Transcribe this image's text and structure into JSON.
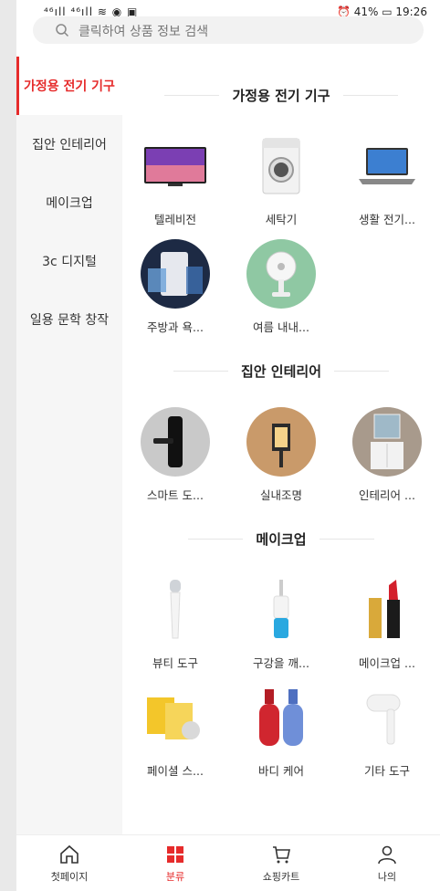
{
  "status": {
    "left": "⁴⁶ıll ⁴⁶ıll ≋ ◉ ▣",
    "battery": "41%",
    "time": "19:26"
  },
  "search": {
    "placeholder": "클릭하여 상품 정보 검색"
  },
  "sidebar": {
    "items": [
      {
        "label": "가정용 전기 기구",
        "active": true
      },
      {
        "label": "집안 인테리어"
      },
      {
        "label": "메이크업"
      },
      {
        "label": "3c 디지털"
      },
      {
        "label": "일용 문학 창작"
      }
    ]
  },
  "sections": [
    {
      "title": "가정용 전기 기구",
      "items": [
        {
          "label": "텔레비전",
          "icon": "tv-icon"
        },
        {
          "label": "세탁기",
          "icon": "washing-machine-icon"
        },
        {
          "label": "생활 전기...",
          "icon": "laptop-icon"
        },
        {
          "label": "주방과 욕...",
          "icon": "water-heater-icon"
        },
        {
          "label": "여름 내내...",
          "icon": "fan-icon"
        }
      ]
    },
    {
      "title": "집안 인테리어",
      "items": [
        {
          "label": "스마트 도...",
          "icon": "smart-lock-icon"
        },
        {
          "label": "실내조명",
          "icon": "lamp-icon"
        },
        {
          "label": "인테리어 ...",
          "icon": "bathroom-cabinet-icon"
        }
      ]
    },
    {
      "title": "메이크업",
      "items": [
        {
          "label": "뷰티 도구",
          "icon": "beauty-brush-icon"
        },
        {
          "label": "구강을 깨...",
          "icon": "water-flosser-icon"
        },
        {
          "label": "메이크업 ...",
          "icon": "lipstick-icon"
        },
        {
          "label": "페이셜 스...",
          "icon": "facial-mask-icon"
        },
        {
          "label": "바디 케어",
          "icon": "body-wash-icon"
        },
        {
          "label": "기타 도구",
          "icon": "hair-dryer-icon"
        }
      ]
    }
  ],
  "tabbar": {
    "home": "첫페이지",
    "category": "분류",
    "cart": "쇼핑카트",
    "me": "나의"
  },
  "colors": {
    "accent": "#e62b2b"
  }
}
